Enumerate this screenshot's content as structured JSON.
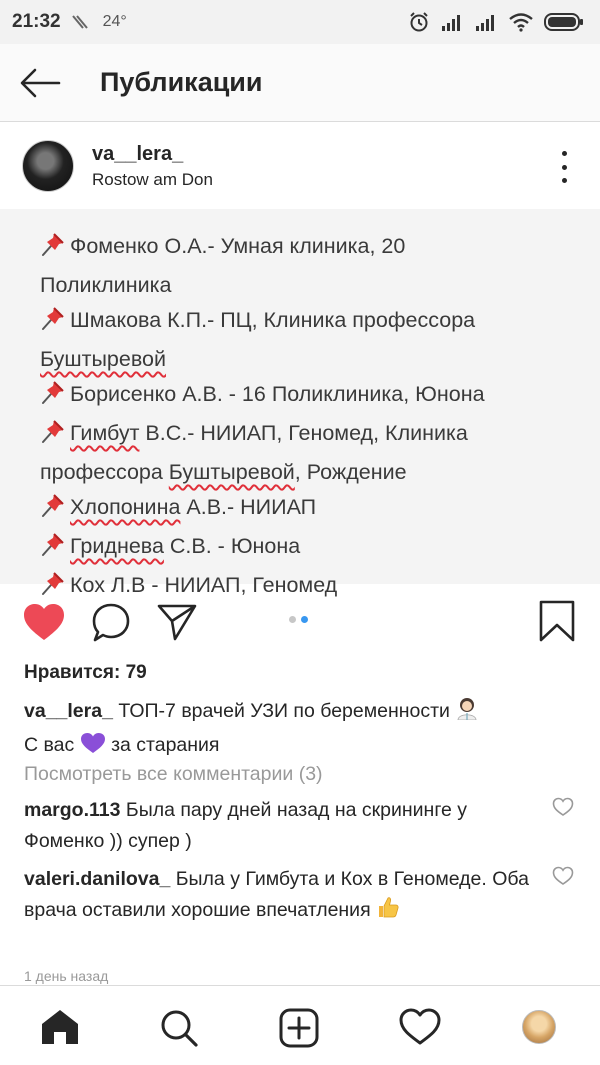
{
  "status_bar": {
    "time": "21:32",
    "temperature": "24°",
    "icons": [
      "alarm-icon",
      "signal-icon",
      "signal-icon",
      "wifi-icon",
      "battery-icon"
    ]
  },
  "header": {
    "title": "Публикации",
    "back_icon": "arrow-left-icon"
  },
  "post": {
    "username": "va__lera_",
    "location": "Rostow am Don",
    "image_lines": [
      {
        "pin": true,
        "pre": "Фоменко О.А.- Умная клиника, 20",
        "squig": "",
        "post": ""
      },
      {
        "pin": false,
        "pre": "Поликлиника",
        "squig": "",
        "post": ""
      },
      {
        "pin": true,
        "pre": "Шмакова К.П.- ПЦ, Клиника профессора",
        "squig": "",
        "post": ""
      },
      {
        "pin": false,
        "pre": "",
        "squig": "Буштыревой",
        "post": ""
      },
      {
        "pin": true,
        "pre": "Борисенко А.В. - 16 Поликлиника, Юнона",
        "squig": "",
        "post": ""
      },
      {
        "pin": true,
        "pre": "",
        "squig": "Гимбут",
        "post": " В.С.- НИИАП, Геномед, Клиника"
      },
      {
        "pin": false,
        "pre": "профессора ",
        "squig": "Буштыревой",
        "post": ", Рождение"
      },
      {
        "pin": true,
        "pre": "",
        "squig": "Хлопонина",
        "post": " А.В.- НИИАП"
      },
      {
        "pin": true,
        "pre": "",
        "squig": "Гриднева",
        "post": " С.В. - Юнона"
      },
      {
        "pin": true,
        "pre": "Кох Л.В - НИИАП, Геномед",
        "squig": "",
        "post": ""
      }
    ],
    "likes": "Нравится: 79",
    "caption_user": "va__lera_",
    "caption_text_1": " ТОП-7 врачей УЗИ по беременности",
    "caption_text_2": "С вас ",
    "caption_text_3": " за старания",
    "view_all": "Посмотреть все комментарии (3)",
    "comments": [
      {
        "user": "margo.113",
        "text": " Была пару дней назад на скрининге у Фоменко )) супер )"
      },
      {
        "user": "valeri.danilova_",
        "text": " Была у Гимбута и Кох в Геномеде. Оба врача оставили хорошие впечатления "
      }
    ],
    "date": "1 день назад"
  },
  "colors": {
    "like_red": "#ed4956",
    "dot_active": "#3897f0",
    "dot_inactive": "#c7c7c7",
    "heart_purple": "#8a4fd8"
  },
  "nav": [
    "home-icon",
    "search-icon",
    "add-icon",
    "activity-icon",
    "profile-avatar"
  ]
}
